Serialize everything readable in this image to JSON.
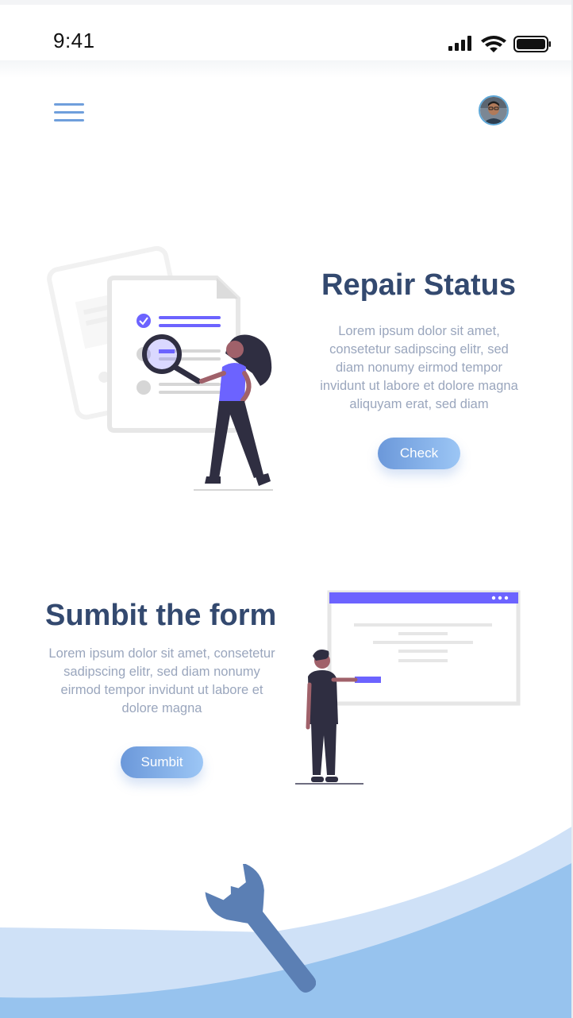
{
  "status_bar": {
    "time": "9:41",
    "icons": [
      "signal-icon",
      "wifi-icon",
      "battery-icon"
    ]
  },
  "header": {
    "menu_icon": "hamburger-menu-icon",
    "avatar": "user-avatar"
  },
  "repair_status": {
    "title": "Repair Status",
    "description": "Lorem ipsum dolor sit amet, consetetur sadipscing elitr, sed diam nonumy eirmod tempor invidunt ut labore et dolore magna aliquyam erat, sed diam",
    "button_label": "Check",
    "illustration": "document-search-illustration"
  },
  "submit_form": {
    "title": "Sumbit the form",
    "description": "Lorem ipsum dolor sit amet, consetetur sadipscing elitr, sed diam nonumy eirmod tempor invidunt ut labore et dolore magna",
    "button_label": "Sumbit",
    "illustration": "whiteboard-presenter-illustration"
  },
  "footer": {
    "icon": "wrench-icon"
  },
  "colors": {
    "accent": "#6b98da",
    "accent_light": "#9cc6f5",
    "title": "#33496f",
    "body_text": "#9aa6bd",
    "illustration_purple": "#6c63ff",
    "illustration_dark": "#2f2e41",
    "wave_light": "#cfe1f7",
    "wave_mid": "#97c3ee",
    "wrench": "#5b7fb4"
  }
}
